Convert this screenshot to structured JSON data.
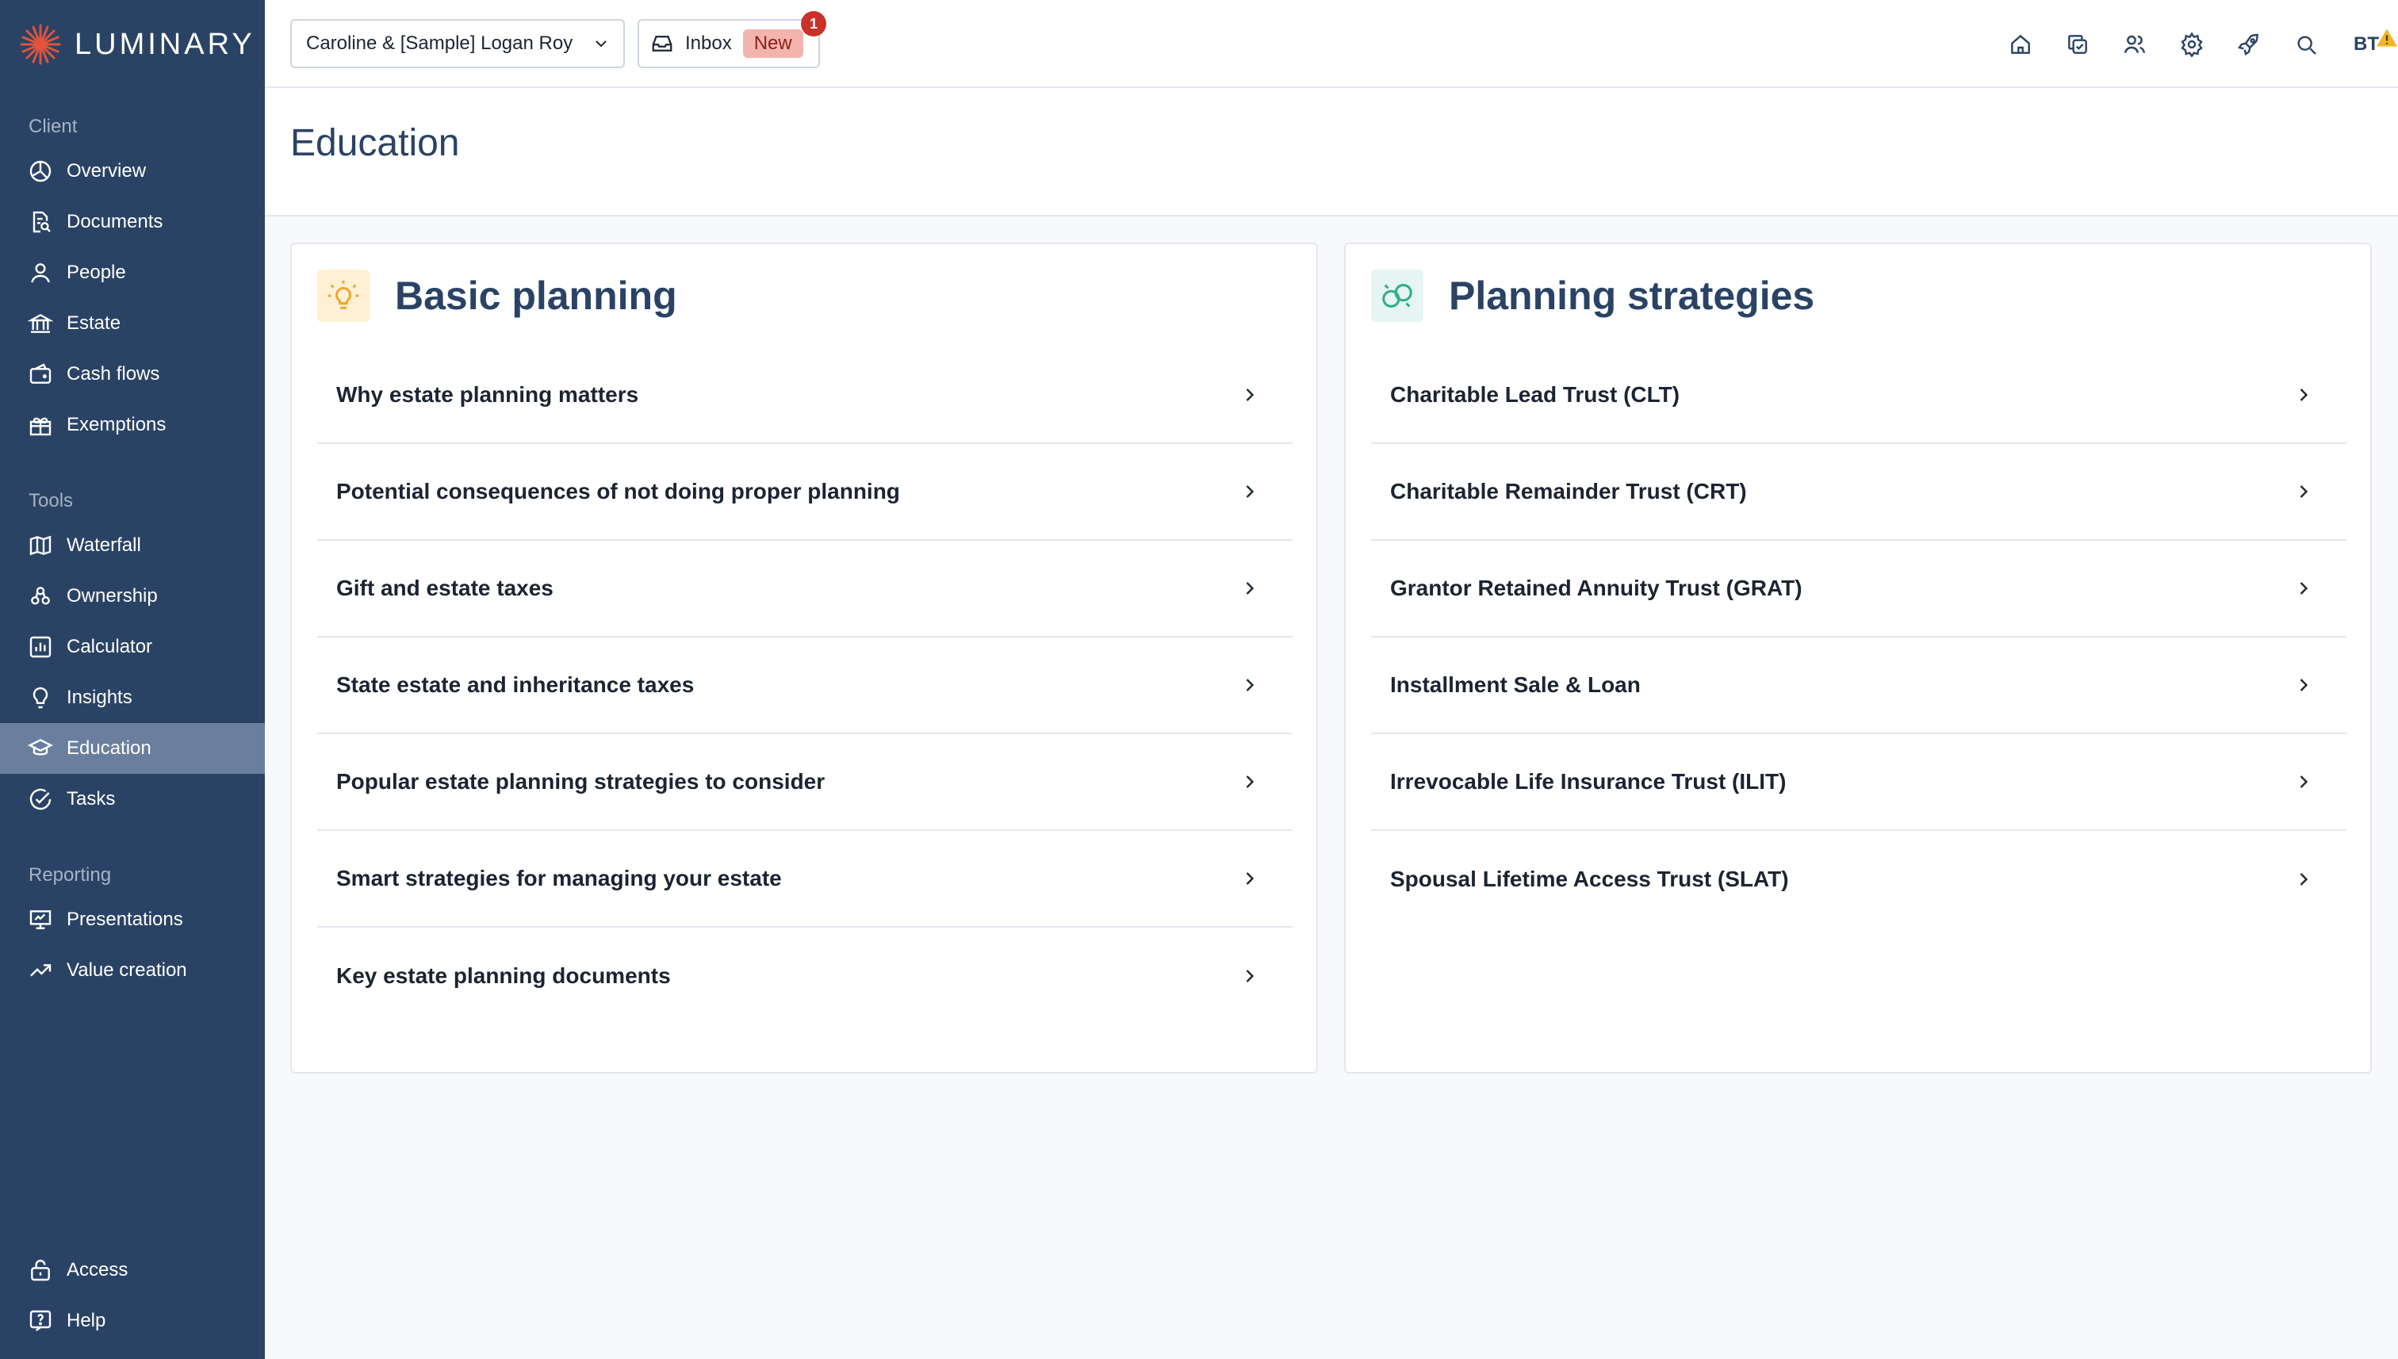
{
  "brand": {
    "name": "LUMINARY"
  },
  "sidebar": {
    "sections": [
      {
        "label": "Client"
      },
      {
        "label": "Tools"
      },
      {
        "label": "Reporting"
      }
    ],
    "client_items": [
      {
        "label": "Overview",
        "icon": "pie-chart-icon"
      },
      {
        "label": "Documents",
        "icon": "document-search-icon"
      },
      {
        "label": "People",
        "icon": "person-icon"
      },
      {
        "label": "Estate",
        "icon": "bank-icon"
      },
      {
        "label": "Cash flows",
        "icon": "wallet-icon"
      },
      {
        "label": "Exemptions",
        "icon": "gift-icon"
      }
    ],
    "tools_items": [
      {
        "label": "Waterfall",
        "icon": "map-icon"
      },
      {
        "label": "Ownership",
        "icon": "ownership-icon"
      },
      {
        "label": "Calculator",
        "icon": "bar-chart-icon"
      },
      {
        "label": "Insights",
        "icon": "lightbulb-icon"
      },
      {
        "label": "Education",
        "icon": "graduation-cap-icon",
        "active": true
      },
      {
        "label": "Tasks",
        "icon": "check-circle-icon"
      }
    ],
    "reporting_items": [
      {
        "label": "Presentations",
        "icon": "presentation-icon"
      },
      {
        "label": "Value creation",
        "icon": "trending-up-icon"
      }
    ],
    "bottom_items": [
      {
        "label": "Access",
        "icon": "lock-icon"
      },
      {
        "label": "Help",
        "icon": "help-icon"
      }
    ]
  },
  "topbar": {
    "client_select": "Caroline & [Sample] Logan Roy",
    "inbox_label": "Inbox",
    "inbox_badge": "New",
    "notification_count": "1",
    "avatar_initials": "BT"
  },
  "page": {
    "title": "Education"
  },
  "cards": {
    "basic": {
      "title": "Basic planning",
      "items": [
        "Why estate planning matters",
        "Potential consequences of not doing proper planning",
        "Gift and estate taxes",
        "State estate and inheritance taxes",
        "Popular estate planning strategies to consider",
        "Smart strategies for managing your estate",
        "Key estate planning documents"
      ]
    },
    "strategies": {
      "title": "Planning strategies",
      "items": [
        "Charitable Lead Trust (CLT)",
        "Charitable Remainder Trust (CRT)",
        "Grantor Retained Annuity Trust (GRAT)",
        "Installment Sale & Loan",
        "Irrevocable Life Insurance Trust (ILIT)",
        "Spousal Lifetime Access Trust (SLAT)"
      ]
    }
  },
  "colors": {
    "sidebar_bg": "#2a4365",
    "active_item_bg": "#6a7f9d",
    "brand_accent": "#e0533d",
    "title_color": "#2a4365",
    "badge_bg": "#f4b4ae",
    "notification_red": "#c8322a",
    "basic_icon_bg": "#fdf0d4",
    "strategies_icon_bg": "#e6f5f1"
  }
}
